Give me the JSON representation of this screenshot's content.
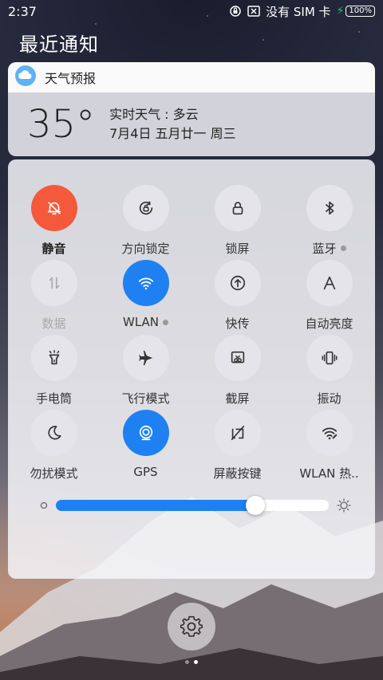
{
  "status_bar": {
    "time": "2:37",
    "carrier": "没有 SIM 卡",
    "battery": "100%"
  },
  "notifications": {
    "title": "最近通知",
    "weather": {
      "app_name": "天气预报",
      "temperature": "35°",
      "condition": "实时天气 : 多云",
      "date": "7月4日   五月廿一  周三"
    }
  },
  "quick_settings": {
    "tiles": [
      {
        "label": "静音",
        "icon": "mute-bell-icon",
        "active": true,
        "color": "#f4593c"
      },
      {
        "label": "方向锁定",
        "icon": "rotation-lock-icon",
        "active": false
      },
      {
        "label": "锁屏",
        "icon": "lock-icon",
        "active": false
      },
      {
        "label": "蓝牙",
        "icon": "bluetooth-icon",
        "active": false,
        "has_dot": true
      },
      {
        "label": "数据",
        "icon": "data-arrows-icon",
        "active": false,
        "disabled": true
      },
      {
        "label": "WLAN",
        "icon": "wifi-icon",
        "active": true,
        "has_dot": true,
        "color": "#1f80f2"
      },
      {
        "label": "快传",
        "icon": "quick-transfer-icon",
        "active": false
      },
      {
        "label": "自动亮度",
        "icon": "auto-brightness-icon",
        "active": false
      },
      {
        "label": "手电筒",
        "icon": "flashlight-icon",
        "active": false
      },
      {
        "label": "飞行模式",
        "icon": "airplane-icon",
        "active": false
      },
      {
        "label": "截屏",
        "icon": "screenshot-icon",
        "active": false
      },
      {
        "label": "振动",
        "icon": "vibrate-icon",
        "active": false
      },
      {
        "label": "勿扰模式",
        "icon": "moon-icon",
        "active": false
      },
      {
        "label": "GPS",
        "icon": "gps-icon",
        "active": true,
        "color": "#1f80f2"
      },
      {
        "label": "屏蔽按键",
        "icon": "block-keys-icon",
        "active": false
      },
      {
        "label": "WLAN 热..",
        "icon": "hotspot-icon",
        "active": false
      }
    ],
    "brightness": {
      "level": 0.73
    }
  },
  "pager": {
    "pages": 2,
    "current": 1
  }
}
